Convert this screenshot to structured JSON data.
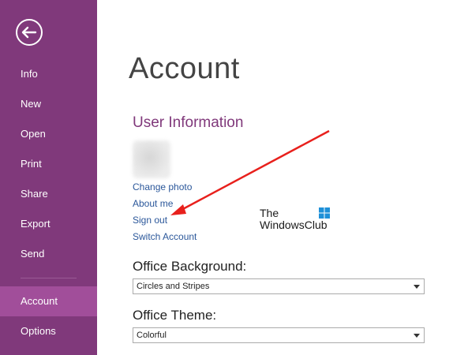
{
  "sidebar": {
    "items": [
      {
        "label": "Info",
        "active": false
      },
      {
        "label": "New",
        "active": false
      },
      {
        "label": "Open",
        "active": false
      },
      {
        "label": "Print",
        "active": false
      },
      {
        "label": "Share",
        "active": false
      },
      {
        "label": "Export",
        "active": false
      },
      {
        "label": "Send",
        "active": false
      },
      {
        "label": "Account",
        "active": true
      },
      {
        "label": "Options",
        "active": false
      }
    ]
  },
  "main": {
    "title": "Account",
    "user_info": {
      "heading": "User Information",
      "links": [
        "Change photo",
        "About me",
        "Sign out",
        "Switch Account"
      ]
    },
    "background": {
      "label": "Office Background:",
      "value": "Circles and Stripes"
    },
    "theme": {
      "label": "Office Theme:",
      "value": "Colorful"
    }
  },
  "watermark": {
    "line1": "The",
    "line2": "WindowsClub"
  },
  "colors": {
    "sidebar": "#80397b",
    "sidebar_active": "#a14e9a",
    "heading": "#80397b",
    "link": "#2b579a",
    "arrow": "#e8201c"
  }
}
